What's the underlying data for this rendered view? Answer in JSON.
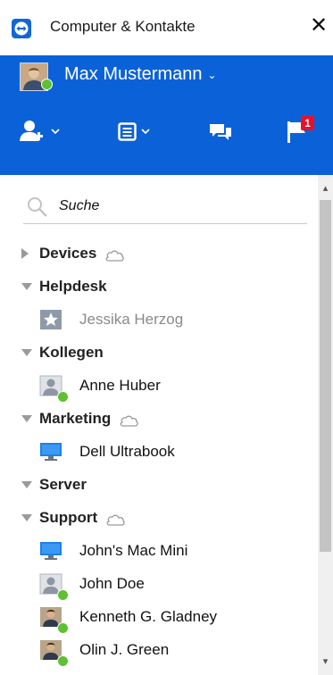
{
  "window": {
    "title": "Computer & Kontakte",
    "close_label": "✕"
  },
  "user": {
    "name": "Max Mustermann",
    "status": "online"
  },
  "toolbar": [
    {
      "id": "add-contact",
      "icon": "add-user-icon"
    },
    {
      "id": "list-menu",
      "icon": "list-icon"
    },
    {
      "id": "chat",
      "icon": "chat-icon"
    },
    {
      "id": "notifications",
      "icon": "flag-icon",
      "badge": "1"
    }
  ],
  "search": {
    "placeholder": "Suche"
  },
  "tree": [
    {
      "type": "group",
      "label": "Devices",
      "expanded": false,
      "cloud": true
    },
    {
      "type": "group",
      "label": "Helpdesk",
      "expanded": true,
      "cloud": false
    },
    {
      "type": "item",
      "label": "Jessika Herzog",
      "icon": "star-contact-icon",
      "status": "offline"
    },
    {
      "type": "group",
      "label": "Kollegen",
      "expanded": true,
      "cloud": false
    },
    {
      "type": "item",
      "label": "Anne Huber",
      "icon": "person-icon",
      "status": "online"
    },
    {
      "type": "group",
      "label": "Marketing",
      "expanded": true,
      "cloud": true
    },
    {
      "type": "item",
      "label": "Dell Ultrabook",
      "icon": "monitor-icon",
      "status": "none"
    },
    {
      "type": "group",
      "label": "Server",
      "expanded": true,
      "cloud": false
    },
    {
      "type": "group",
      "label": "Support",
      "expanded": true,
      "cloud": true
    },
    {
      "type": "item",
      "label": "John's Mac Mini",
      "icon": "monitor-icon",
      "status": "none"
    },
    {
      "type": "item",
      "label": "John Doe",
      "icon": "person-icon",
      "status": "online"
    },
    {
      "type": "item",
      "label": "Kenneth G. Gladney",
      "icon": "photo-avatar-icon",
      "status": "online"
    },
    {
      "type": "item",
      "label": "Olin J. Green",
      "icon": "photo-avatar-icon",
      "status": "online"
    }
  ],
  "colors": {
    "header": "#0b62d8",
    "online": "#5fc032",
    "badge": "#e8102a"
  }
}
